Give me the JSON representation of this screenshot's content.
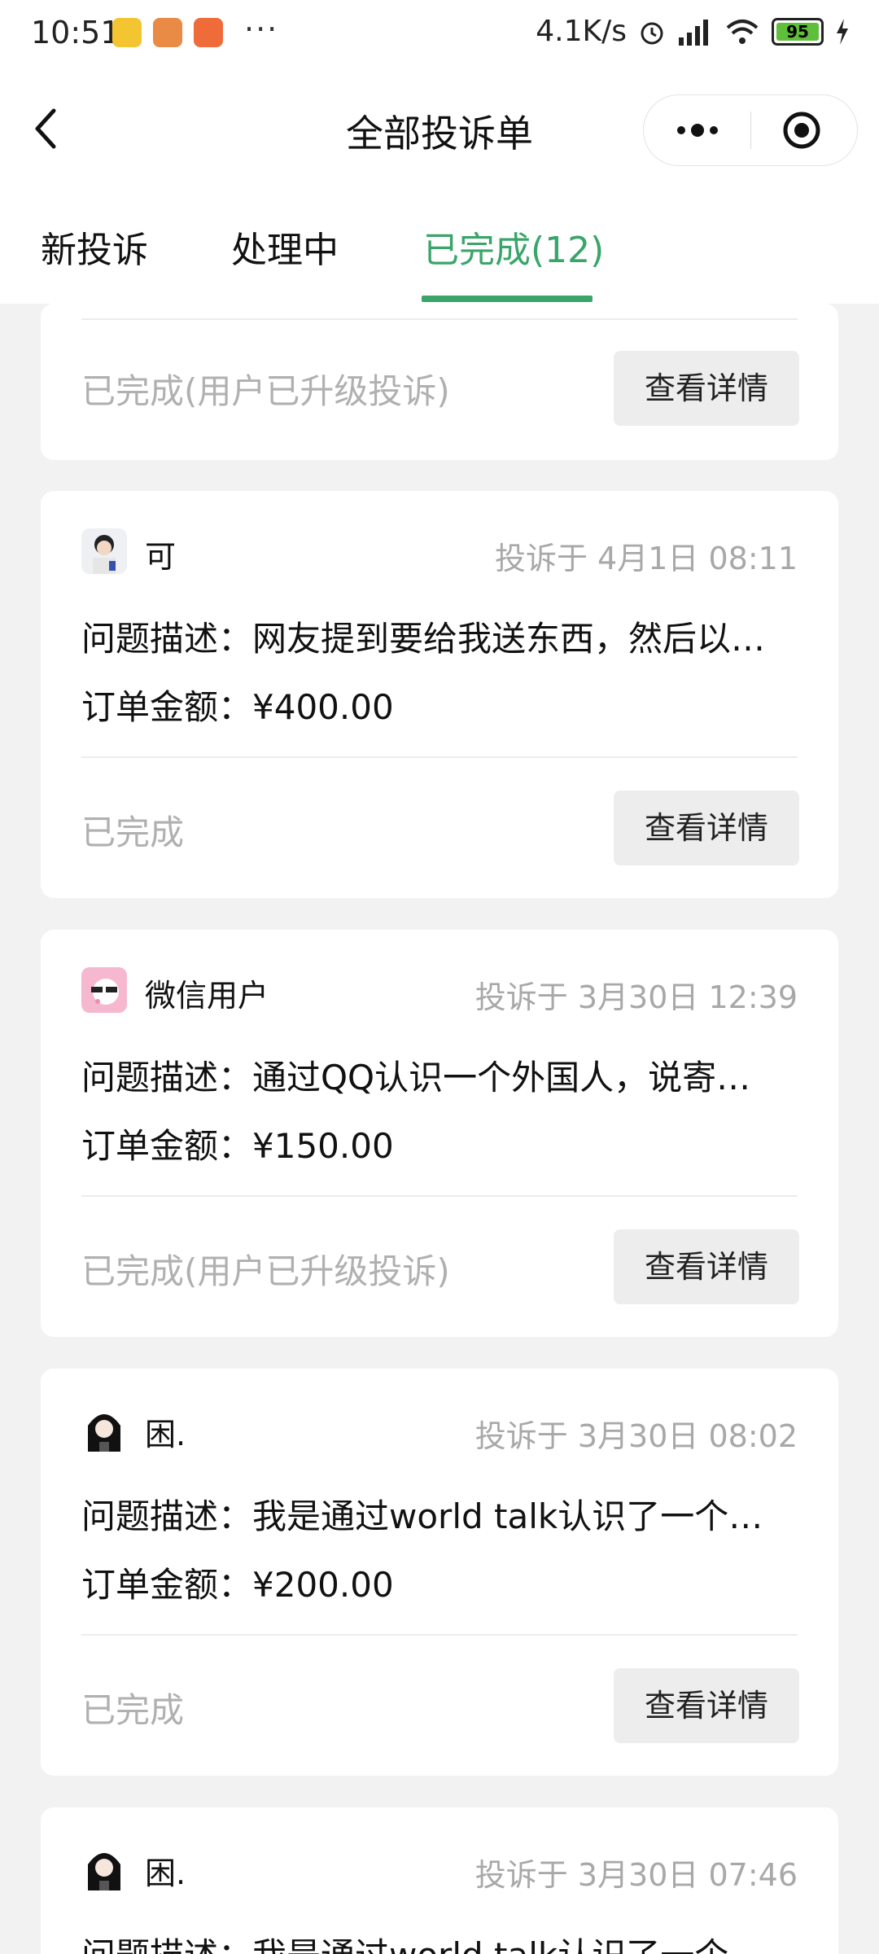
{
  "status_bar": {
    "time": "10:51",
    "more": "···",
    "network_speed": "4.1K/s",
    "battery_level": "95"
  },
  "nav": {
    "title": "全部投诉单"
  },
  "tabs": [
    {
      "label": "新投诉",
      "active": false
    },
    {
      "label": "处理中",
      "active": false
    },
    {
      "label": "已完成(12)",
      "active": true
    }
  ],
  "colors": {
    "accent": "#3aa56a",
    "muted_text": "#b0b0b0",
    "background": "#f2f2f2"
  },
  "cards": [
    {
      "status": "已完成(用户已升级投诉)",
      "detail_button": "查看详情"
    },
    {
      "user": "可",
      "time": "投诉于 4月1日 08:11",
      "description": "问题描述：网友提到要给我送东西，然后以…",
      "amount": "订单金额：¥400.00",
      "status": "已完成",
      "detail_button": "查看详情"
    },
    {
      "user": "微信用户",
      "time": "投诉于 3月30日 12:39",
      "description": "问题描述：通过QQ认识一个外国人，说寄…",
      "amount": "订单金额：¥150.00",
      "status": "已完成(用户已升级投诉)",
      "detail_button": "查看详情"
    },
    {
      "user": "困.",
      "time": "投诉于 3月30日 08:02",
      "description": "问题描述：我是通过world talk认识了一个…",
      "amount": "订单金额：¥200.00",
      "status": "已完成",
      "detail_button": "查看详情"
    },
    {
      "user": "困.",
      "time": "投诉于 3月30日 07:46",
      "description": "问题描述：我是通过world talk认识了一个…"
    }
  ]
}
